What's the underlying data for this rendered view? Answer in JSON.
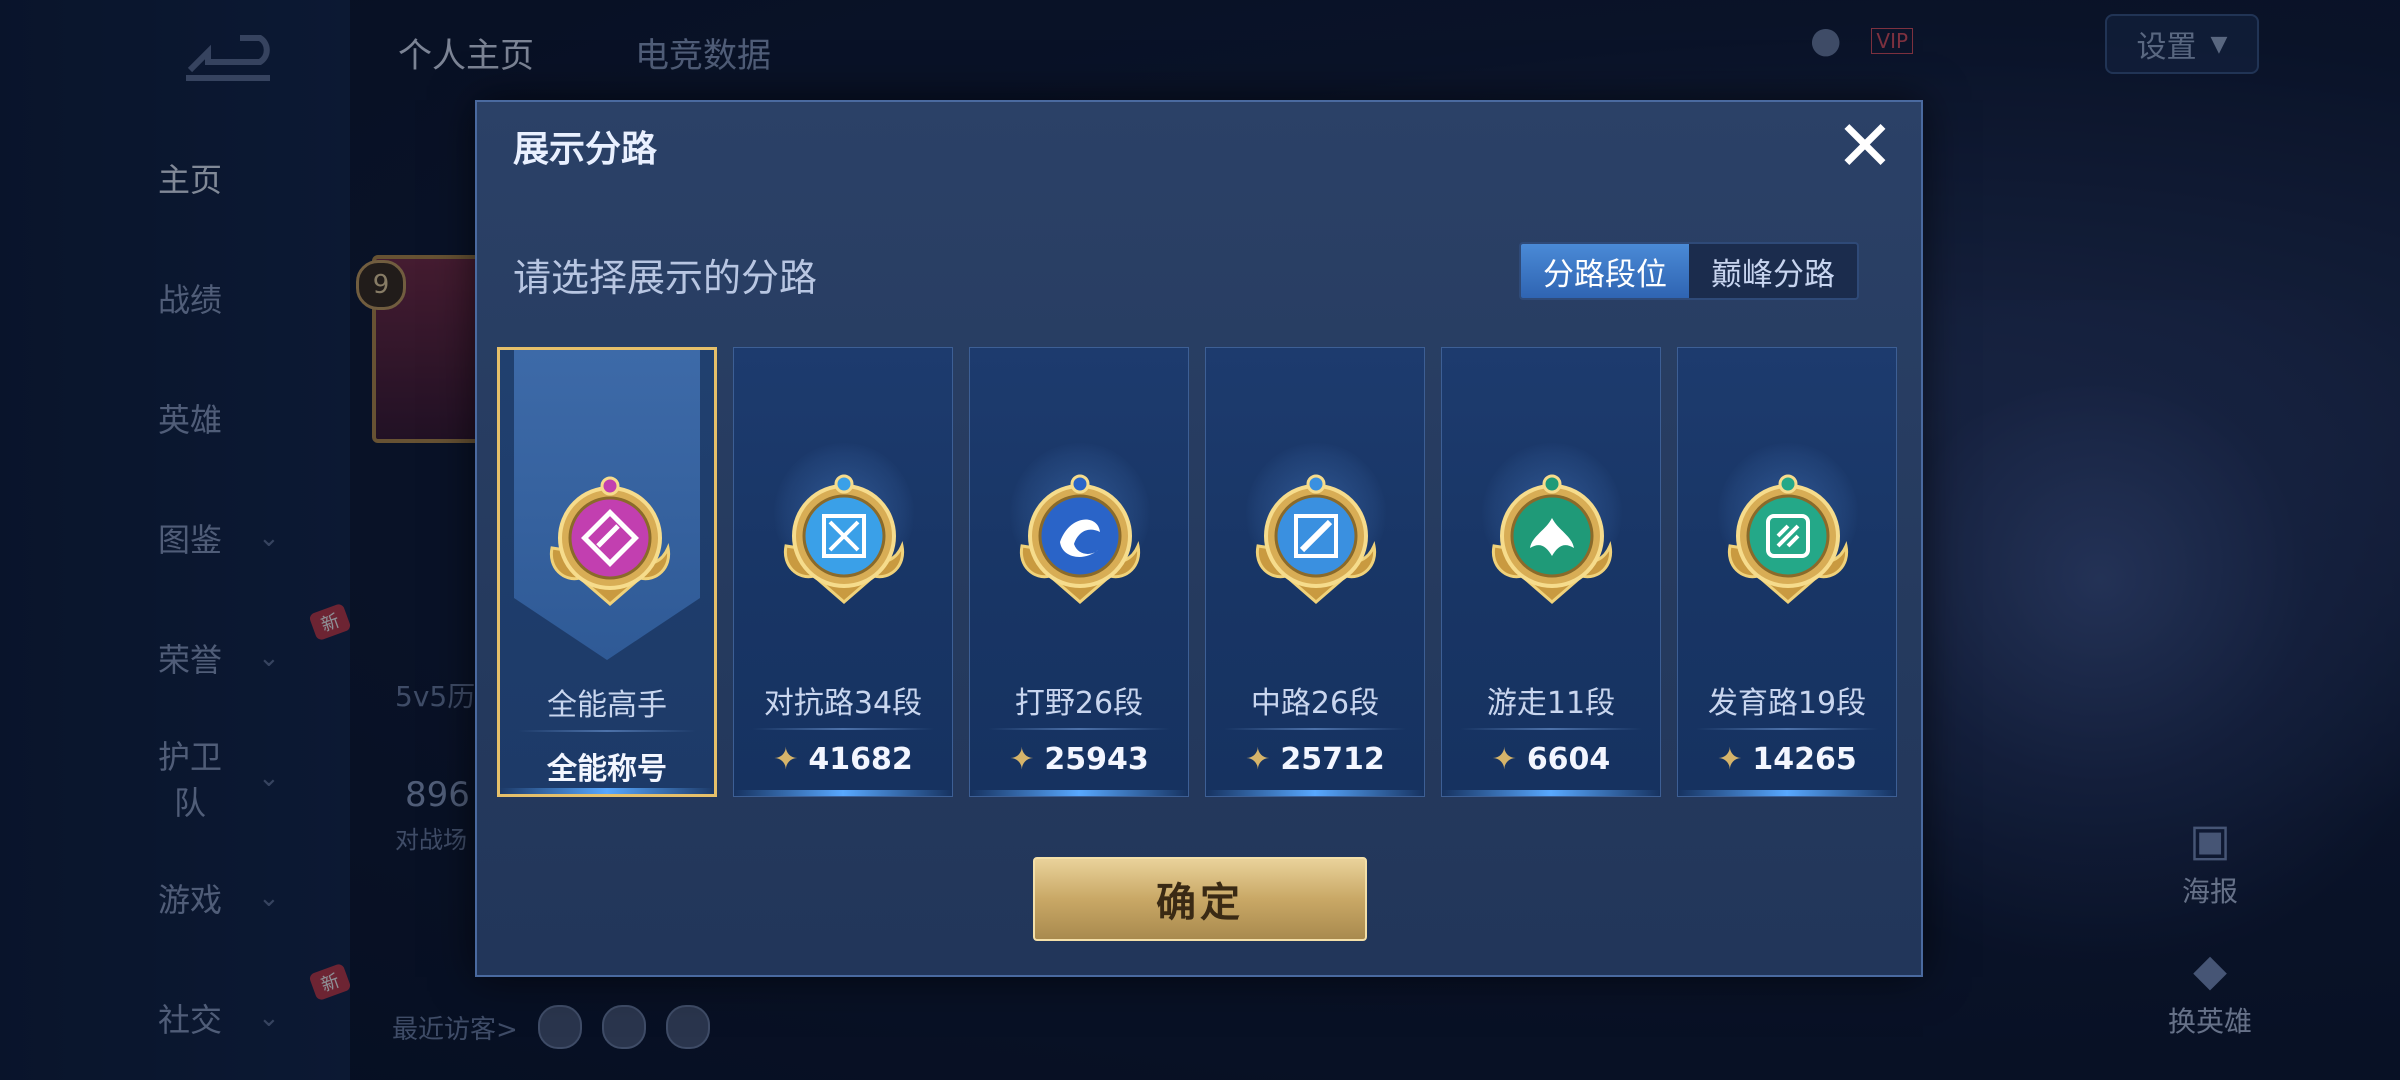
{
  "background": {
    "sidebar": {
      "items": [
        {
          "label": "主页",
          "active": true
        },
        {
          "label": "战绩"
        },
        {
          "label": "英雄"
        },
        {
          "label": "图鉴",
          "chevron": true
        },
        {
          "label": "荣誉",
          "chevron": true,
          "badge": "新"
        },
        {
          "label": "护卫队",
          "chevron": true
        },
        {
          "label": "游戏",
          "chevron": true
        },
        {
          "label": "社交",
          "chevron": true,
          "badge": "新"
        }
      ]
    },
    "tabs": [
      "个人主页",
      "电竞数据"
    ],
    "level": "9",
    "mode_text": "5v5历",
    "count_text": "896",
    "count_sub": "对战场",
    "recent_visitors_label": "最近访客>",
    "settings_label": "设置",
    "vip_label": "VIP",
    "right_buttons": [
      {
        "label": "海报",
        "icon": "poster-icon"
      },
      {
        "label": "换英雄",
        "icon": "swap-hero-icon"
      }
    ]
  },
  "modal": {
    "title": "展示分路",
    "subtitle": "请选择展示的分路",
    "segment": {
      "options": [
        "分路段位",
        "巅峰分路"
      ],
      "selected": "分路段位"
    },
    "cards": [
      {
        "name": "全能高手",
        "value": "全能称号",
        "emblem": "all-round-emblem-icon",
        "color": "#c23fb0",
        "selected": true
      },
      {
        "name": "对抗路34段",
        "value": "41682",
        "emblem": "clash-lane-emblem-icon",
        "color": "#3aa0e8"
      },
      {
        "name": "打野26段",
        "value": "25943",
        "emblem": "jungle-emblem-icon",
        "color": "#2a64c8"
      },
      {
        "name": "中路26段",
        "value": "25712",
        "emblem": "mid-lane-emblem-icon",
        "color": "#3a90e0"
      },
      {
        "name": "游走11段",
        "value": "6604",
        "emblem": "roam-emblem-icon",
        "color": "#1f9a78"
      },
      {
        "name": "发育路19段",
        "value": "14265",
        "emblem": "farm-lane-emblem-icon",
        "color": "#24a888"
      }
    ],
    "confirm_label": "确定"
  }
}
